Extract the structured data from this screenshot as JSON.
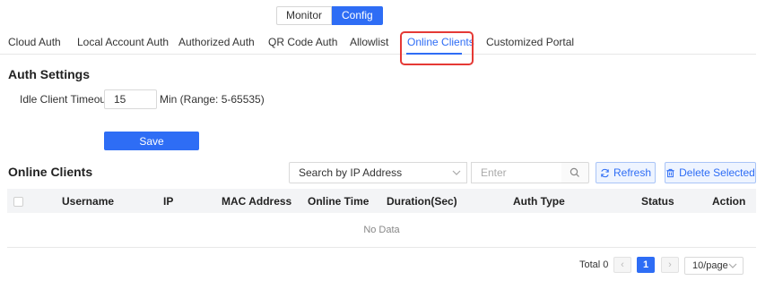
{
  "mode_switch": {
    "monitor": "Monitor",
    "config": "Config"
  },
  "tabs": [
    {
      "label": "Cloud Auth"
    },
    {
      "label": "Local Account Auth"
    },
    {
      "label": "Authorized Auth"
    },
    {
      "label": "QR Code Auth"
    },
    {
      "label": "Allowlist"
    },
    {
      "label": "Online Clients",
      "active": true
    },
    {
      "label": "Customized Portal"
    }
  ],
  "auth_settings": {
    "title": "Auth Settings",
    "idle_timeout_label": "Idle Client Timeout",
    "idle_timeout_value": "15",
    "idle_timeout_unit": "Min (Range: 5-65535)",
    "save_label": "Save"
  },
  "online_clients": {
    "title": "Online Clients",
    "search_type": "Search by IP Address",
    "search_placeholder": "Enter",
    "refresh_label": "Refresh",
    "delete_label": "Delete Selected",
    "columns": [
      "Username",
      "IP",
      "MAC Address",
      "Online Time",
      "Duration(Sec)",
      "Auth Type",
      "Status",
      "Action"
    ],
    "empty_text": "No Data"
  },
  "pagination": {
    "total_label": "Total 0",
    "current_page": "1",
    "page_size": "10/page",
    "prev_icon": "‹",
    "next_icon": "›"
  },
  "colors": {
    "accent": "#2e6df5",
    "highlight": "#e53935"
  }
}
